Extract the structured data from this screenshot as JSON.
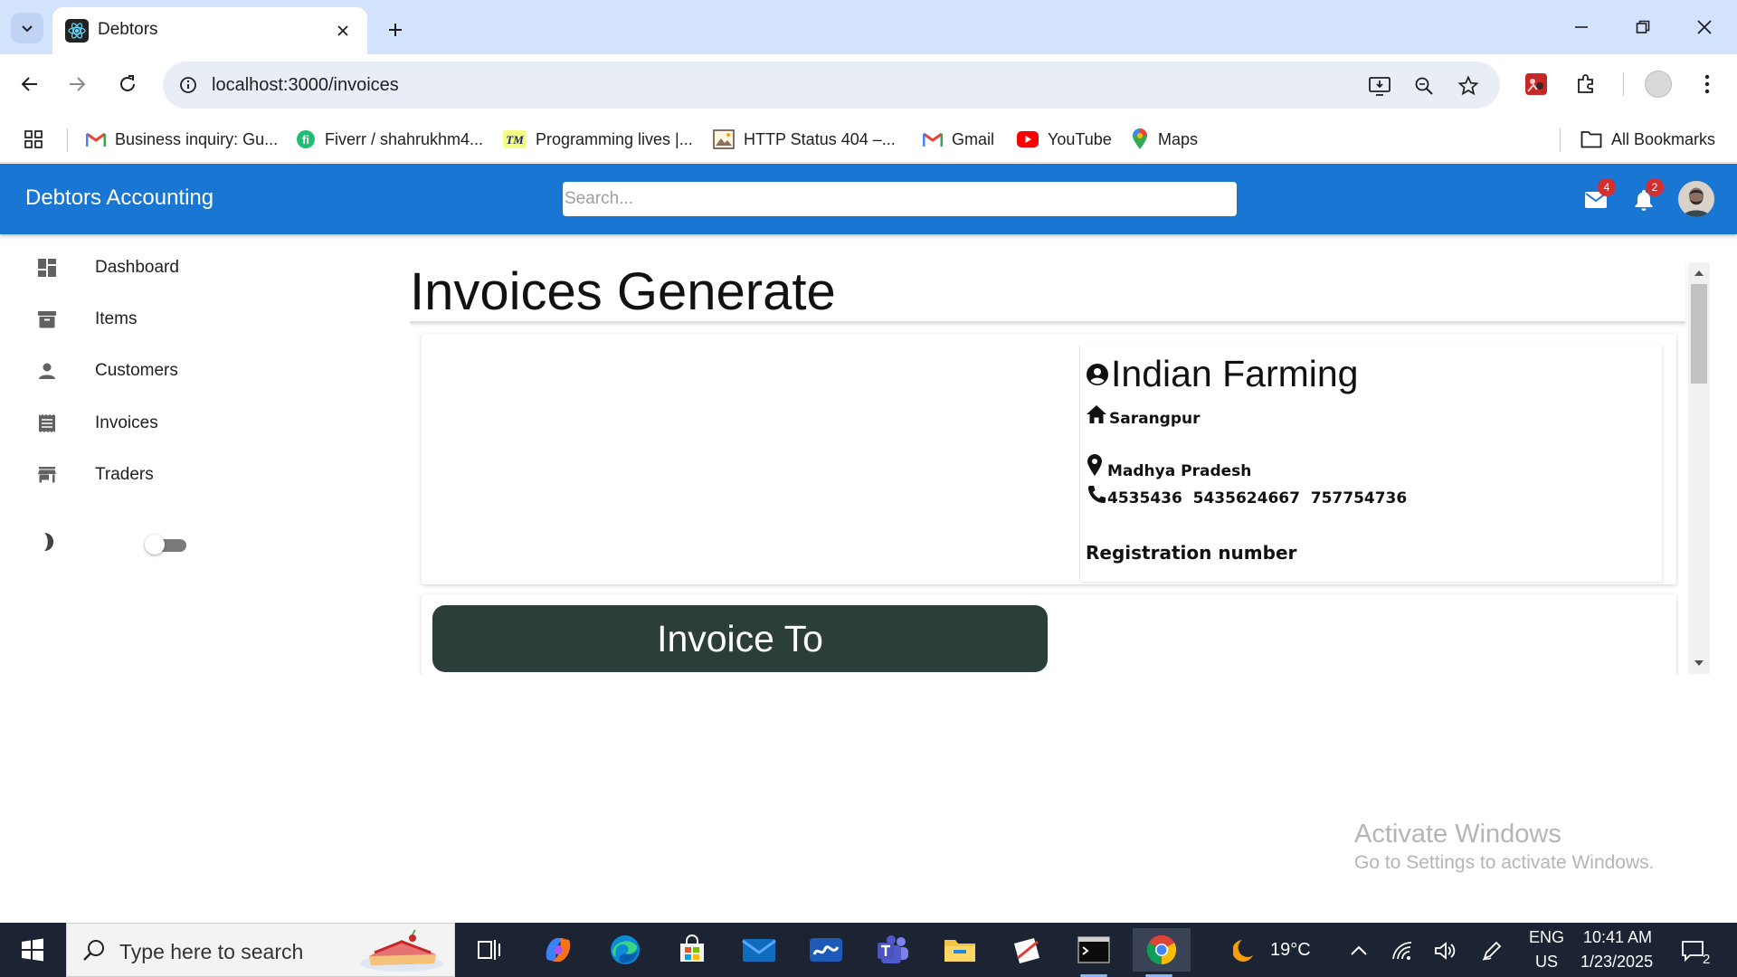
{
  "browser": {
    "tab_title": "Debtors",
    "url": "localhost:3000/invoices",
    "bookmarks": [
      {
        "label": "Business inquiry: Gu...",
        "icon": "gmail-icon"
      },
      {
        "label": "Fiverr / shahrukhm4...",
        "icon": "fiverr-icon"
      },
      {
        "label": "Programming lives |...",
        "icon": "tm-icon"
      },
      {
        "label": "HTTP Status 404 –...",
        "icon": "image-icon"
      },
      {
        "label": "Gmail",
        "icon": "gmail-icon"
      },
      {
        "label": "YouTube",
        "icon": "youtube-icon"
      },
      {
        "label": "Maps",
        "icon": "maps-icon"
      }
    ],
    "all_bookmarks_label": "All Bookmarks"
  },
  "app": {
    "title": "Debtors Accounting",
    "search_placeholder": "Search...",
    "mail_count": "4",
    "notification_count": "2",
    "brand_color": "#1976d2"
  },
  "sidebar": {
    "items": [
      {
        "label": "Dashboard",
        "icon": "dashboard-icon"
      },
      {
        "label": "Items",
        "icon": "archive-icon"
      },
      {
        "label": "Customers",
        "icon": "person-icon"
      },
      {
        "label": "Invoices",
        "icon": "receipt-icon"
      },
      {
        "label": "Traders",
        "icon": "store-icon"
      }
    ],
    "dark_mode_enabled": false
  },
  "main": {
    "page_title": "Invoices Generate",
    "company": {
      "name": "Indian Farming",
      "city": "Sarangpur",
      "state": "Madhya Pradesh",
      "phones": "4535436  5435624667  757754736",
      "registration_label": "Registration number"
    },
    "invoice_to_label": "Invoice To",
    "invoice_to_color": "#2c3e3a"
  },
  "watermark": {
    "title": "Activate Windows",
    "subtitle": "Go to Settings to activate Windows."
  },
  "taskbar": {
    "search_placeholder": "Type here to search",
    "weather": "19°C",
    "language": "ENG",
    "region": "US",
    "time": "10:41 AM",
    "date": "1/23/2025",
    "notification_count": "2"
  }
}
